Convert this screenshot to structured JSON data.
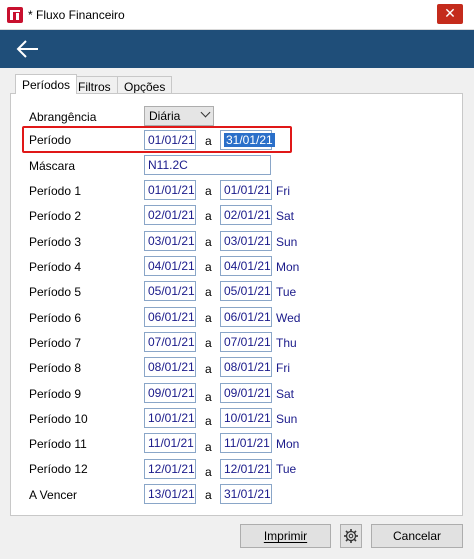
{
  "window": {
    "title": "* Fluxo Financeiro",
    "close_label": "✕"
  },
  "tabs": [
    "Períodos",
    "Filtros",
    "Opções"
  ],
  "abrangencia": {
    "label": "Abrangência",
    "value": "Diária"
  },
  "periodo": {
    "label": "Período",
    "from": "01/01/21",
    "sep": "a",
    "to": "31/01/21"
  },
  "mascara": {
    "label": "Máscara",
    "value": "N11.2C"
  },
  "periods": [
    {
      "label": "Período 1",
      "from": "01/01/21",
      "sep": "a",
      "to": "01/01/21",
      "day": "Fri"
    },
    {
      "label": "Período 2",
      "from": "02/01/21",
      "sep": "a",
      "to": "02/01/21",
      "day": "Sat"
    },
    {
      "label": "Período 3",
      "from": "03/01/21",
      "sep": "a",
      "to": "03/01/21",
      "day": "Sun"
    },
    {
      "label": "Período 4",
      "from": "04/01/21",
      "sep": "a",
      "to": "04/01/21",
      "day": "Mon"
    },
    {
      "label": "Período 5",
      "from": "05/01/21",
      "sep": "a",
      "to": "05/01/21",
      "day": "Tue"
    },
    {
      "label": "Período 6",
      "from": "06/01/21",
      "sep": "a",
      "to": "06/01/21",
      "day": "Wed"
    },
    {
      "label": "Período 7",
      "from": "07/01/21",
      "sep": "a",
      "to": "07/01/21",
      "day": "Thu"
    },
    {
      "label": "Período 8",
      "from": "08/01/21",
      "sep": "a",
      "to": "08/01/21",
      "day": "Fri"
    },
    {
      "label": "Período 9",
      "from": "09/01/21",
      "sep": "a",
      "to": "09/01/21",
      "day": "Sat"
    },
    {
      "label": "Período 10",
      "from": "10/01/21",
      "sep": "a",
      "to": "10/01/21",
      "day": "Sun"
    },
    {
      "label": "Período 11",
      "from": "11/01/21",
      "sep": "a",
      "to": "11/01/21",
      "day": "Mon"
    },
    {
      "label": "Período 12",
      "from": "12/01/21",
      "sep": "a",
      "to": "12/01/21",
      "day": "Tue"
    }
  ],
  "a_vencer": {
    "label": "A Vencer",
    "from": "13/01/21",
    "sep": "a",
    "to": "31/01/21"
  },
  "buttons": {
    "print": "Imprimir",
    "cancel": "Cancelar"
  },
  "icons": {
    "back": "back-arrow-icon",
    "settings": "gear-icon",
    "app": "app-logo-icon",
    "dropdown": "chevron-down-icon"
  },
  "colors": {
    "header": "#1f4e79",
    "highlight": "#e01818",
    "selection": "#2a6fc9",
    "close": "#c42b1c"
  }
}
